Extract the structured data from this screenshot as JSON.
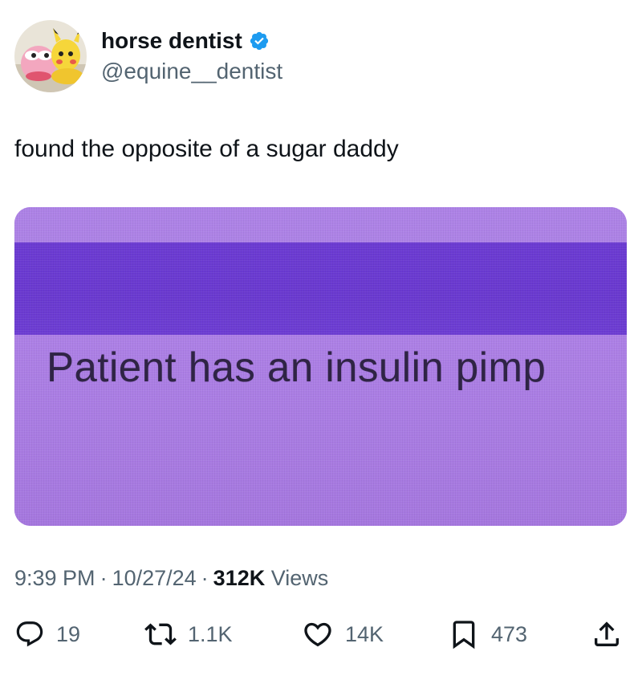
{
  "author": {
    "display_name": "horse dentist",
    "handle": "@equine__dentist",
    "verified": true,
    "avatar_icon": "avatar-image"
  },
  "tweet": {
    "text": "found the opposite of a sugar daddy",
    "media": {
      "caption_text": "Patient has an insulin pimp"
    }
  },
  "meta": {
    "time": "9:39 PM",
    "separator": "·",
    "date": "10/27/24",
    "views_count": "312K",
    "views_label": "Views"
  },
  "actions": {
    "reply": {
      "icon": "reply-icon",
      "count": "19"
    },
    "retweet": {
      "icon": "retweet-icon",
      "count": "1.1K"
    },
    "like": {
      "icon": "heart-icon",
      "count": "14K"
    },
    "bookmark": {
      "icon": "bookmark-icon",
      "count": "473"
    },
    "share": {
      "icon": "share-icon"
    }
  },
  "colors": {
    "verified_badge": "#1d9bf0",
    "secondary_text": "#536471",
    "primary_text": "#0f1419",
    "media_purple": "#a779e0",
    "media_bar": "#6b3ad2"
  }
}
